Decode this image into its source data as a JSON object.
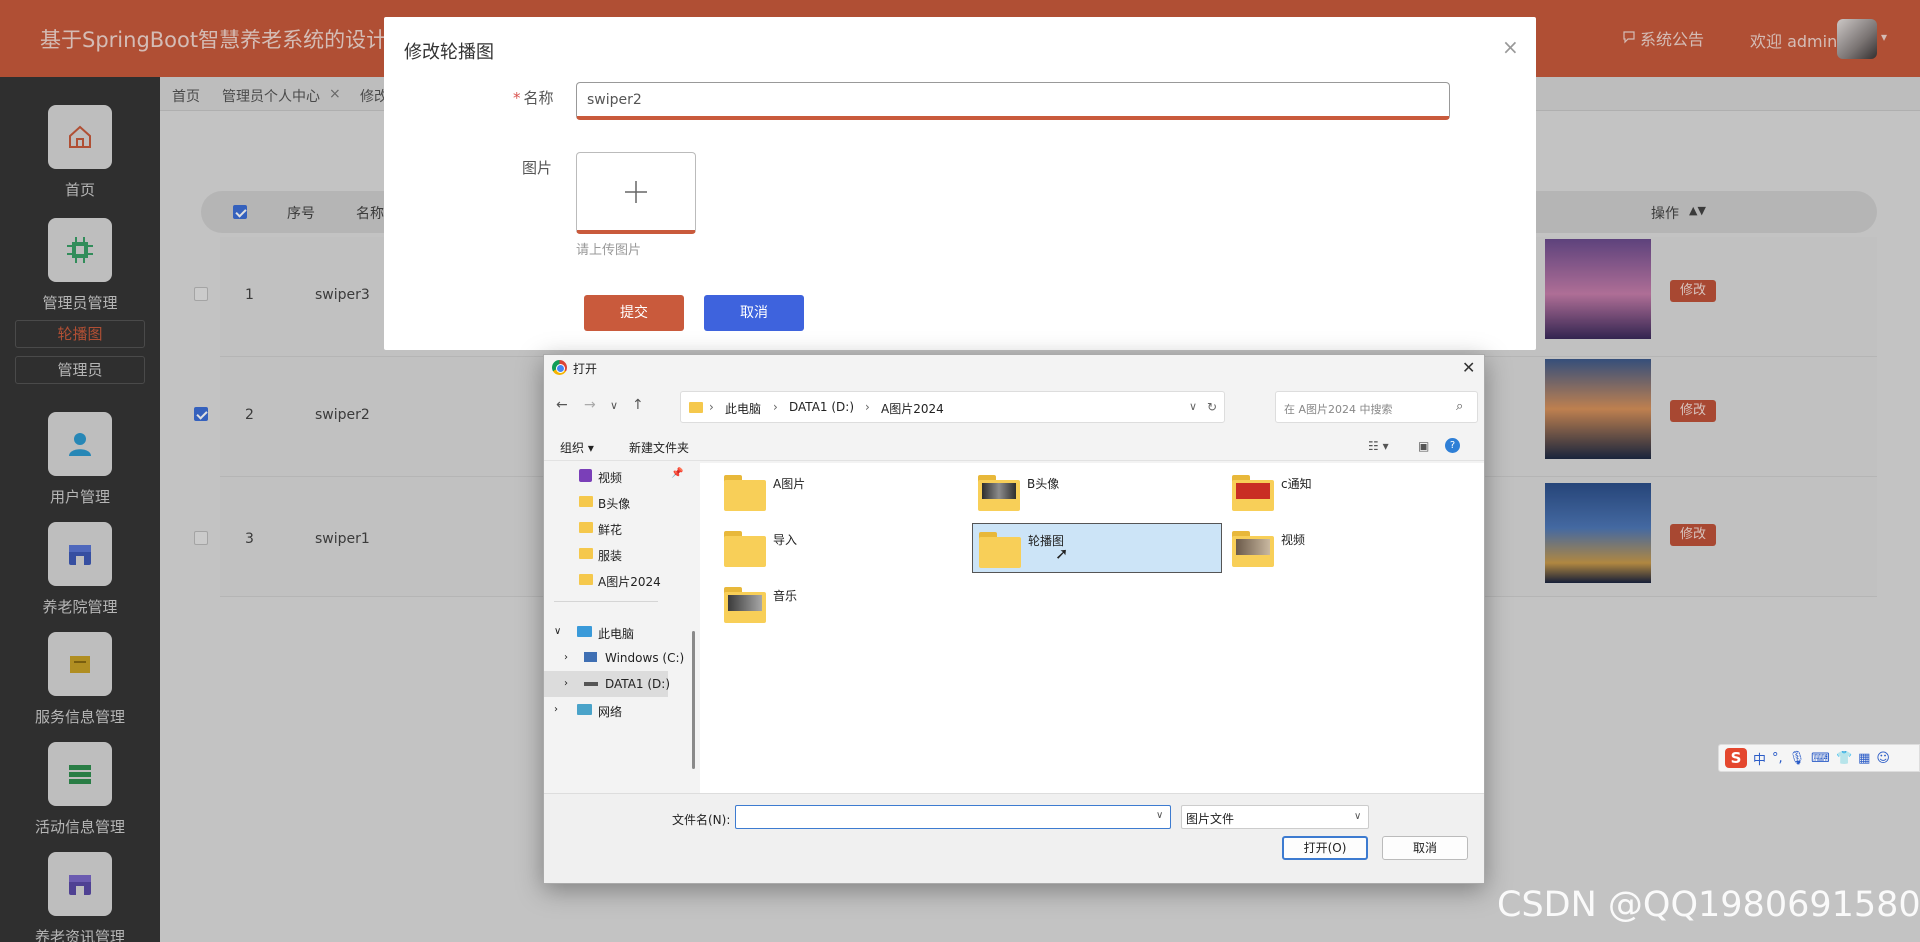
{
  "app": {
    "title": "基于SpringBoot智慧养老系统的设计与实现",
    "notice": "系统公告",
    "welcome": "欢迎 admin"
  },
  "sidebar": {
    "items": [
      {
        "label": "首页",
        "icon": "home-icon"
      },
      {
        "label": "管理员管理",
        "icon": "chip-icon"
      },
      {
        "label": "用户管理",
        "icon": "user-icon"
      },
      {
        "label": "养老院管理",
        "icon": "store-icon"
      },
      {
        "label": "服务信息管理",
        "icon": "box-icon"
      },
      {
        "label": "活动信息管理",
        "icon": "list-icon"
      },
      {
        "label": "养老资讯管理",
        "icon": "store-icon"
      }
    ],
    "subitems": [
      "轮播图",
      "管理员"
    ]
  },
  "breadcrumb": [
    "首页",
    "管理员个人中心",
    "修改"
  ],
  "table": {
    "headers": [
      "序号",
      "名称",
      "操作"
    ],
    "rows": [
      {
        "index": "1",
        "name": "swiper3",
        "checked": false,
        "action": "修改"
      },
      {
        "index": "2",
        "name": "swiper2",
        "checked": true,
        "action": "修改"
      },
      {
        "index": "3",
        "name": "swiper1",
        "checked": false,
        "action": "修改"
      }
    ]
  },
  "modal": {
    "title": "修改轮播图",
    "name_label": "名称",
    "name_value": "swiper2",
    "image_label": "图片",
    "upload_hint": "请上传图片",
    "submit": "提交",
    "cancel": "取消"
  },
  "dialog": {
    "title": "打开",
    "address": [
      "此电脑",
      "DATA1 (D:)",
      "A图片2024"
    ],
    "search_placeholder": "在 A图片2024 中搜索",
    "organize": "组织",
    "new_folder": "新建文件夹",
    "nav_items": [
      "视频",
      "B头像",
      "鲜花",
      "服装",
      "A图片2024",
      "此电脑",
      "Windows (C:)",
      "DATA1 (D:)",
      "网络"
    ],
    "folders": [
      "A图片",
      "B头像",
      "c通知",
      "导入",
      "轮播图",
      "视频",
      "音乐"
    ],
    "filename_label": "文件名(N):",
    "filename_value": "",
    "filetype": "图片文件",
    "open": "打开(O)",
    "cancel": "取消"
  },
  "watermark": "CSDN @QQ1980691580",
  "ime": {
    "lang": "中"
  },
  "colors": {
    "brand": "#c95a3c",
    "sidebar": "#363636",
    "primary_blue": "#3e63dd"
  }
}
